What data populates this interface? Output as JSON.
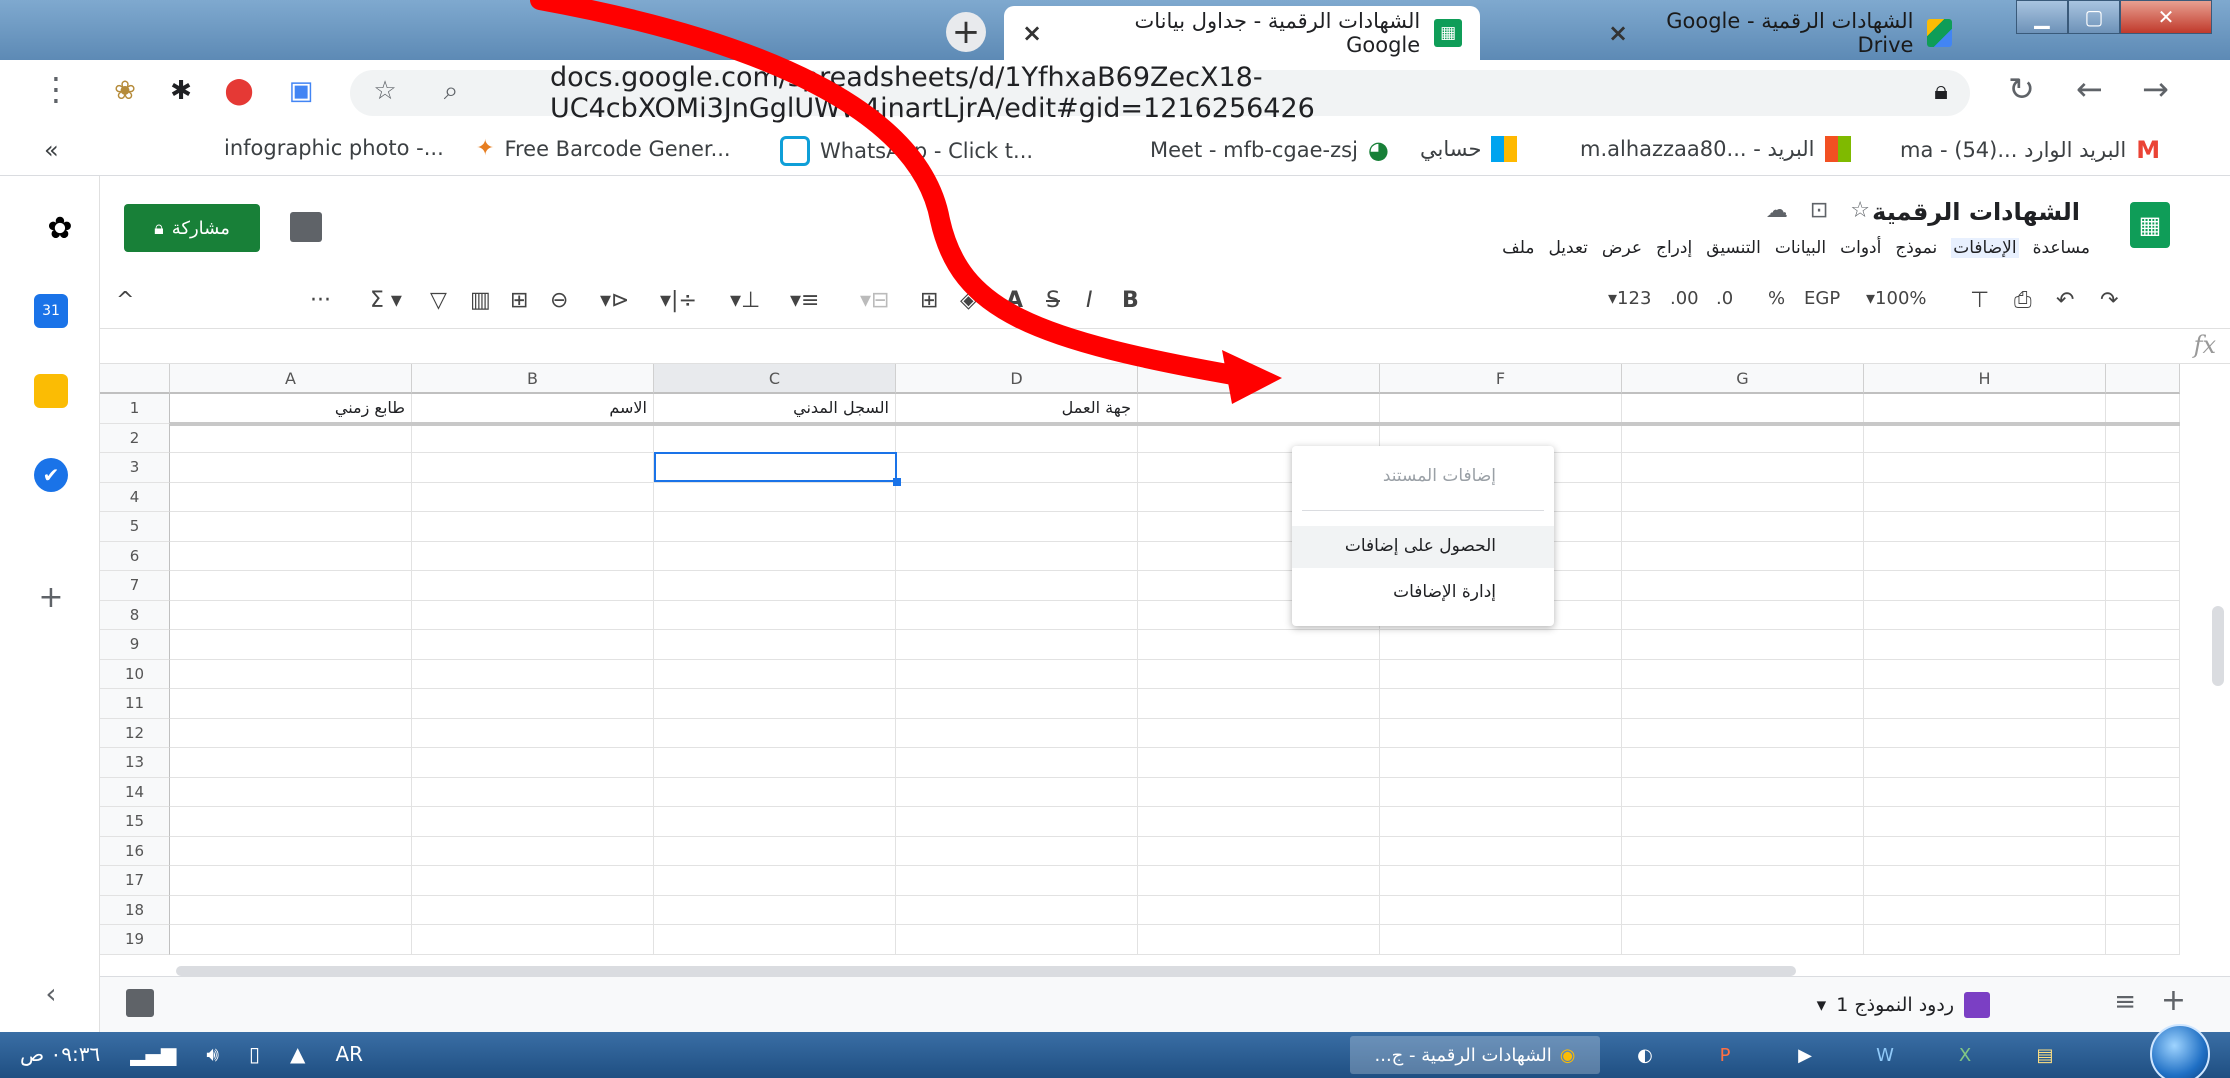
{
  "browser": {
    "tabs": [
      {
        "title": "الشهادات الرقمية - Google Drive",
        "icon": "drive-icon",
        "active": false
      },
      {
        "title": "الشهادات الرقمية - جداول بيانات Google",
        "icon": "sheets-icon",
        "active": true
      }
    ],
    "url": "docs.google.com/spreadsheets/d/1YfhxaB69ZecX18-UC4cbXOMi3JnGglUWw4jnartLjrA/edit#gid=1216256426",
    "bookmarks": [
      {
        "label": "البريد الوارد ...ma - (54)",
        "icon": "gmail-icon"
      },
      {
        "label": "البريد - ...m.alhazzaa80",
        "icon": "office-icon"
      },
      {
        "label": "حسابي",
        "icon": "office-icon"
      },
      {
        "label": "Meet - mfb-cgae-zsj",
        "icon": "meet-icon"
      },
      {
        "label": "WhatsApp - Click t...",
        "icon": "whatsapp-icon"
      },
      {
        "label": "Free Barcode Gener...",
        "icon": "barcode-icon"
      },
      {
        "label": "infographic photo -...",
        "icon": "infographic-icon"
      }
    ],
    "more_bookmarks": "«"
  },
  "sheets": {
    "doc_title": "الشهادات الرقمية",
    "share_label": "مشاركة",
    "menu": [
      {
        "label": "ملف"
      },
      {
        "label": "تعديل"
      },
      {
        "label": "عرض"
      },
      {
        "label": "إدراج"
      },
      {
        "label": "التنسيق"
      },
      {
        "label": "البيانات"
      },
      {
        "label": "أدوات"
      },
      {
        "label": "نموذج"
      },
      {
        "label": "الإضافات",
        "active": true
      },
      {
        "label": "مساعدة"
      }
    ],
    "toolbar": {
      "zoom": "100%",
      "currency": "EGP",
      "percent": "%",
      "dec_decrease": ".0",
      "dec_increase": ".00",
      "format_123": "123",
      "more": "···"
    },
    "columns": [
      "A",
      "B",
      "C",
      "D",
      "E",
      "F",
      "G",
      "H"
    ],
    "rows": [
      "1",
      "2",
      "3",
      "4",
      "5",
      "6",
      "7",
      "8",
      "9",
      "10",
      "11",
      "12",
      "13",
      "14",
      "15",
      "16",
      "17",
      "18",
      "19"
    ],
    "header_row": [
      "طابع زمني",
      "الاسم",
      "السجل المدني",
      "جهة العمل"
    ],
    "dropdown": {
      "section_label": "إضافات المستند",
      "items": [
        "الحصول على إضافات",
        "إدارة الإضافات"
      ]
    },
    "sheet_tab": "ردود النموذج 1",
    "fx": "fx"
  },
  "taskbar": {
    "clock": "٠٩:٣٦ ص",
    "lang": "AR",
    "active_window": "الشهادات الرقمية - ج..."
  },
  "colors": {
    "sheets_green": "#0f9d58",
    "share_green": "#188038",
    "selection_blue": "#1a73e8",
    "arrow_red": "#ff0000"
  }
}
